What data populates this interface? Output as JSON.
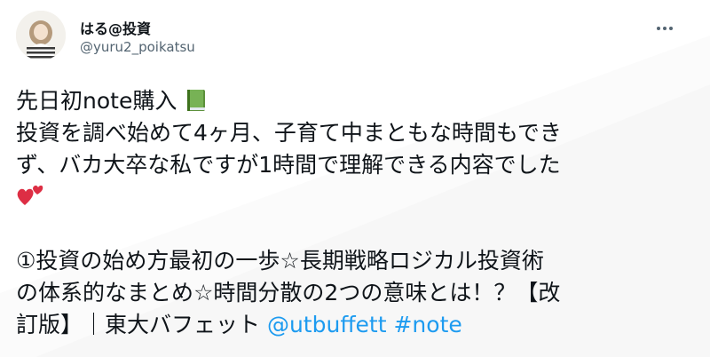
{
  "author": {
    "display_name": "はる@投資",
    "username": "@yuru2_poikatsu",
    "avatar_icon": "user-avatar-icon"
  },
  "more_icon": "more-horizontal-icon",
  "tweet": {
    "line1_text": "先日初note購入",
    "line1_emoji": "green-book-icon",
    "line2": "投資を調べ始めて4ヶ月、子育て中まともな時間もでき",
    "line3": "ず、バカ大卒な私ですが1時間で理解できる内容でした",
    "line4_emoji": "two-hearts-icon",
    "line5": "①投資の始め方最初の一歩☆長期戦略ロジカル投資術",
    "line6": "の体系的なまとめ☆時間分散の2つの意味とは！？【改",
    "line7_text": "訂版】｜東大バフェット ",
    "mention": "@utbuffett",
    "hashtag": "#note"
  },
  "colors": {
    "text": "#0f1419",
    "secondary": "#536471",
    "link": "#1d9bf0",
    "background": "#ffffff"
  }
}
